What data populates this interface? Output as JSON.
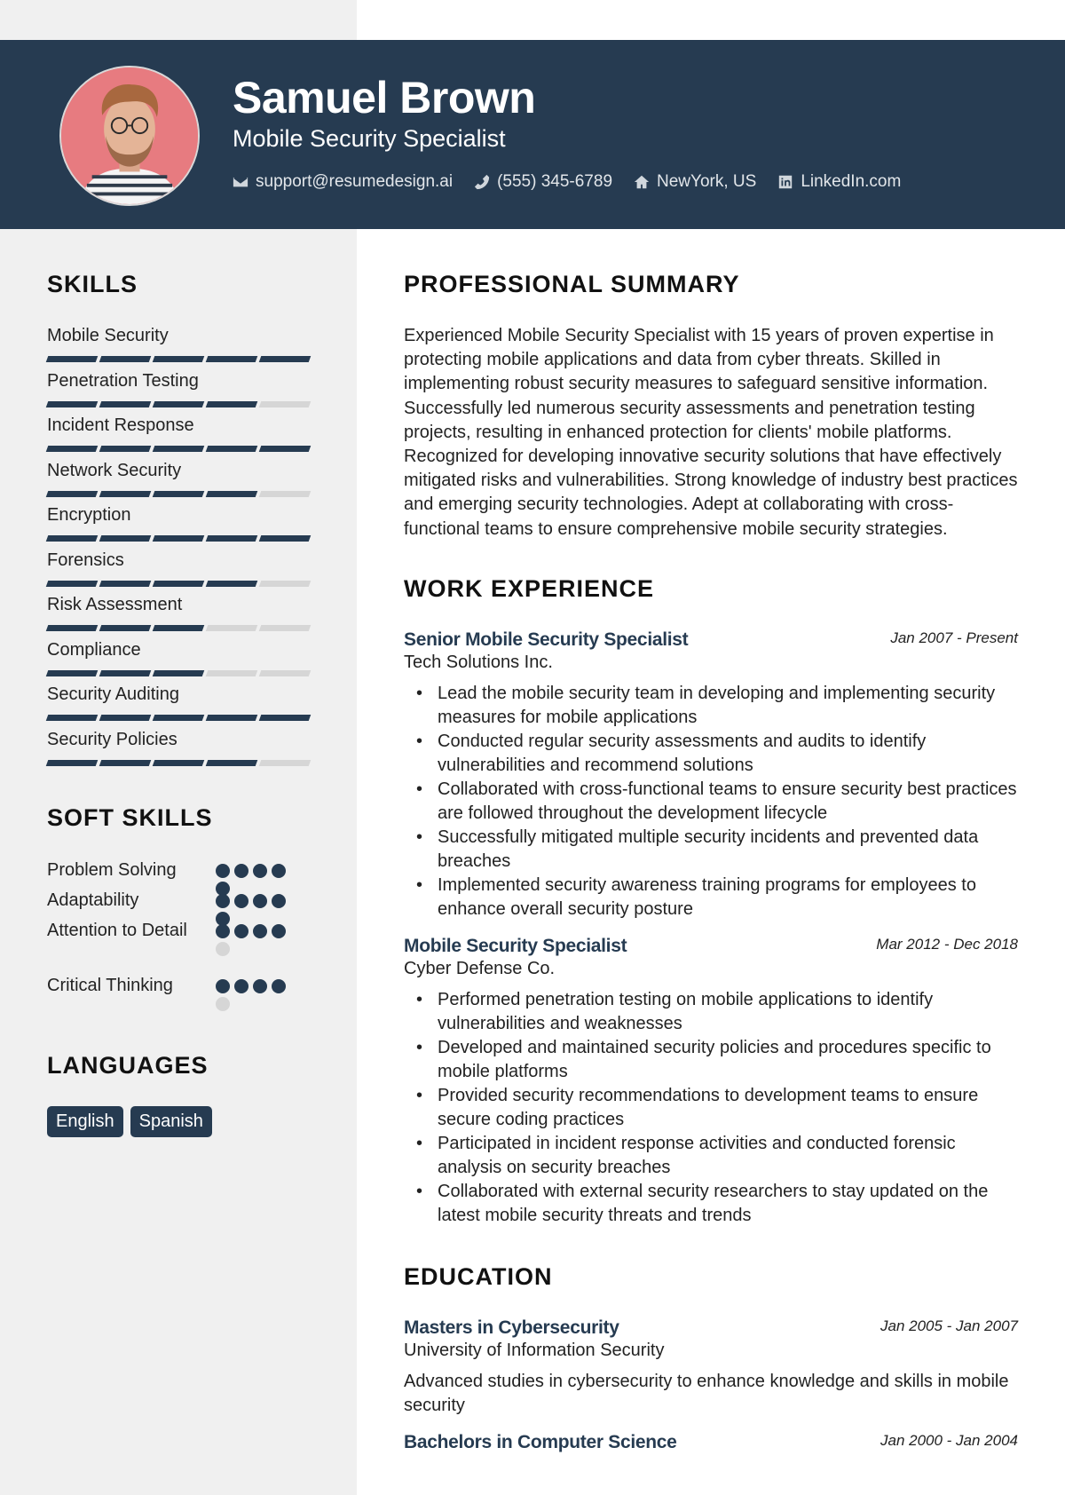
{
  "header": {
    "name": "Samuel Brown",
    "title": "Mobile Security Specialist",
    "contacts": [
      {
        "icon": "envelope-icon",
        "text": "support@resumedesign.ai"
      },
      {
        "icon": "phone-icon",
        "text": "(555) 345-6789"
      },
      {
        "icon": "home-icon",
        "text": "NewYork, US"
      },
      {
        "icon": "linkedin-icon",
        "text": "LinkedIn.com"
      }
    ]
  },
  "colors": {
    "accent": "#263b51",
    "sidebar": "#f0f0f0",
    "inactive": "#d6d6d6",
    "avatar_bg": "#e77b80"
  },
  "sidebar": {
    "skills_heading": "SKILLS",
    "skills": [
      {
        "name": "Mobile Security",
        "level": 5,
        "max": 5
      },
      {
        "name": "Penetration Testing",
        "level": 4,
        "max": 5
      },
      {
        "name": "Incident Response",
        "level": 5,
        "max": 5
      },
      {
        "name": "Network Security",
        "level": 4,
        "max": 5
      },
      {
        "name": "Encryption",
        "level": 5,
        "max": 5
      },
      {
        "name": "Forensics",
        "level": 4,
        "max": 5
      },
      {
        "name": "Risk Assessment",
        "level": 3,
        "max": 5
      },
      {
        "name": "Compliance",
        "level": 3,
        "max": 5
      },
      {
        "name": "Security Auditing",
        "level": 5,
        "max": 5
      },
      {
        "name": "Security Policies",
        "level": 4,
        "max": 5
      }
    ],
    "soft_skills_heading": "SOFT SKILLS",
    "soft_skills": [
      {
        "name": "Problem Solving",
        "level": 5,
        "max": 5
      },
      {
        "name": "Adaptability",
        "level": 5,
        "max": 5
      },
      {
        "name": "Attention to Detail",
        "level": 4,
        "max": 5
      },
      {
        "name": "Critical Thinking",
        "level": 4,
        "max": 5
      }
    ],
    "languages_heading": "LANGUAGES",
    "languages": [
      "English",
      "Spanish"
    ]
  },
  "main": {
    "summary_heading": "PROFESSIONAL SUMMARY",
    "summary": "Experienced Mobile Security Specialist with 15 years of proven expertise in protecting mobile applications and data from cyber threats. Skilled in implementing robust security measures to safeguard sensitive information. Successfully led numerous security assessments and penetration testing projects, resulting in enhanced protection for clients' mobile platforms. Recognized for developing innovative security solutions that have effectively mitigated risks and vulnerabilities. Strong knowledge of industry best practices and emerging security technologies. Adept at collaborating with cross-functional teams to ensure comprehensive mobile security strategies.",
    "experience_heading": "WORK EXPERIENCE",
    "experience": [
      {
        "title": "Senior Mobile Security Specialist",
        "company": "Tech Solutions Inc.",
        "dates": "Jan 2007 - Present",
        "bullets": [
          "Lead the mobile security team in developing and implementing security measures for mobile applications",
          "Conducted regular security assessments and audits to identify vulnerabilities and recommend solutions",
          "Collaborated with cross-functional teams to ensure security best practices are followed throughout the development lifecycle",
          "Successfully mitigated multiple security incidents and prevented data breaches",
          "Implemented security awareness training programs for employees to enhance overall security posture"
        ]
      },
      {
        "title": "Mobile Security Specialist",
        "company": "Cyber Defense Co.",
        "dates": "Mar 2012 - Dec 2018",
        "bullets": [
          "Performed penetration testing on mobile applications to identify vulnerabilities and weaknesses",
          "Developed and maintained security policies and procedures specific to mobile platforms",
          "Provided security recommendations to development teams to ensure secure coding practices",
          "Participated in incident response activities and conducted forensic analysis on security breaches",
          "Collaborated with external security researchers to stay updated on the latest mobile security threats and trends"
        ]
      }
    ],
    "education_heading": "EDUCATION",
    "education": [
      {
        "degree": "Masters in Cybersecurity",
        "school": "University of Information Security",
        "dates": "Jan 2005 - Jan 2007",
        "description": "Advanced studies in cybersecurity to enhance knowledge and skills in mobile security"
      },
      {
        "degree": "Bachelors in Computer Science",
        "dates": "Jan 2000 - Jan 2004"
      }
    ]
  }
}
